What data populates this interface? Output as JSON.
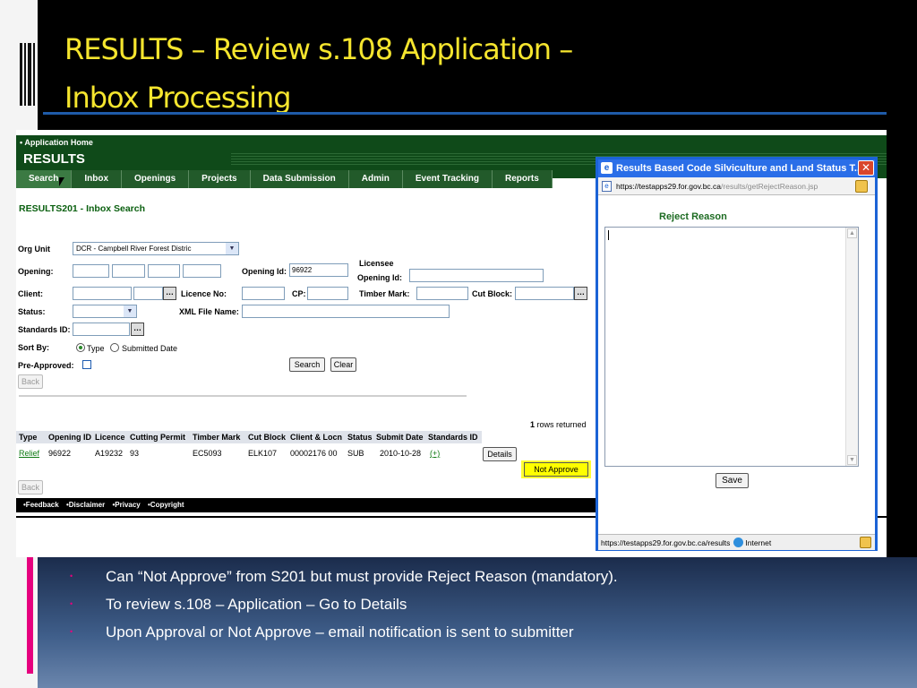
{
  "slide": {
    "title_line1": "RESULTS – Review s.108 Application –",
    "title_line2": "Inbox Processing",
    "bullets": [
      "Can “Not Approve” from S201 but must provide Reject Reason (mandatory).",
      "To review s.108 – Application – Go to Details",
      "Upon Approval or Not Approve – email notification is sent to submitter"
    ],
    "colors": {
      "title": "#f5e52e",
      "bullet_marker": "#e6007e",
      "app_green": "#0f4a19"
    }
  },
  "app": {
    "home_link": "• Application Home",
    "brand": "RESULTS",
    "nav": [
      "Search",
      "Inbox",
      "Openings",
      "Projects",
      "Data Submission",
      "Admin",
      "Event Tracking",
      "Reports"
    ],
    "breadcrumb": "RESULTS201 - Inbox Search",
    "form": {
      "org_unit_label": "Org Unit",
      "org_unit_value": "DCR - Campbell River Forest Distric",
      "opening_label": "Opening:",
      "opening_id_label": "Opening Id:",
      "opening_id_value": "96922",
      "licensee_label": "Licensee",
      "licensee_opening_label": "Opening Id:",
      "client_label": "Client:",
      "licence_no_label": "Licence No:",
      "cp_label": "CP:",
      "timber_mark_label": "Timber Mark:",
      "cut_block_label": "Cut Block:",
      "status_label": "Status:",
      "xml_file_label": "XML File Name:",
      "standards_id_label": "Standards ID:",
      "sort_by_label": "Sort By:",
      "sort_type": "Type",
      "sort_submitted": "Submitted Date",
      "pre_approved_label": "Pre-Approved:",
      "search_button": "Search",
      "clear_button": "Clear",
      "back_button": "Back"
    },
    "results": {
      "count": "1",
      "count_suffix": "rows returned",
      "columns": [
        "Type",
        "Opening ID",
        "Licence",
        "Cutting Permit",
        "Timber Mark",
        "Cut Block",
        "Client & Locn",
        "Status",
        "Submit Date",
        "Standards ID"
      ],
      "row": [
        "Relief",
        "96922",
        "A19232",
        "93",
        "EC5093",
        "ELK107",
        "00002176 00",
        "SUB",
        "2010-10-28",
        "(+)"
      ],
      "details_button": "Details",
      "not_approve_button": "Not Approve",
      "back_button": "Back"
    },
    "footer": [
      "•Feedback",
      "•Disclaimer",
      "•Privacy",
      "•Copyright"
    ]
  },
  "popup": {
    "title": "Results Based Code Silviculture and Land Status T...",
    "url_host": "https://testapps29.for.gov.bc.ca",
    "url_path": "/results/getRejectReason.jsp",
    "reject_label": "Reject Reason",
    "save_button": "Save",
    "status_url": "https://testapps29.for.gov.bc.ca/results",
    "status_zone": "Internet"
  }
}
